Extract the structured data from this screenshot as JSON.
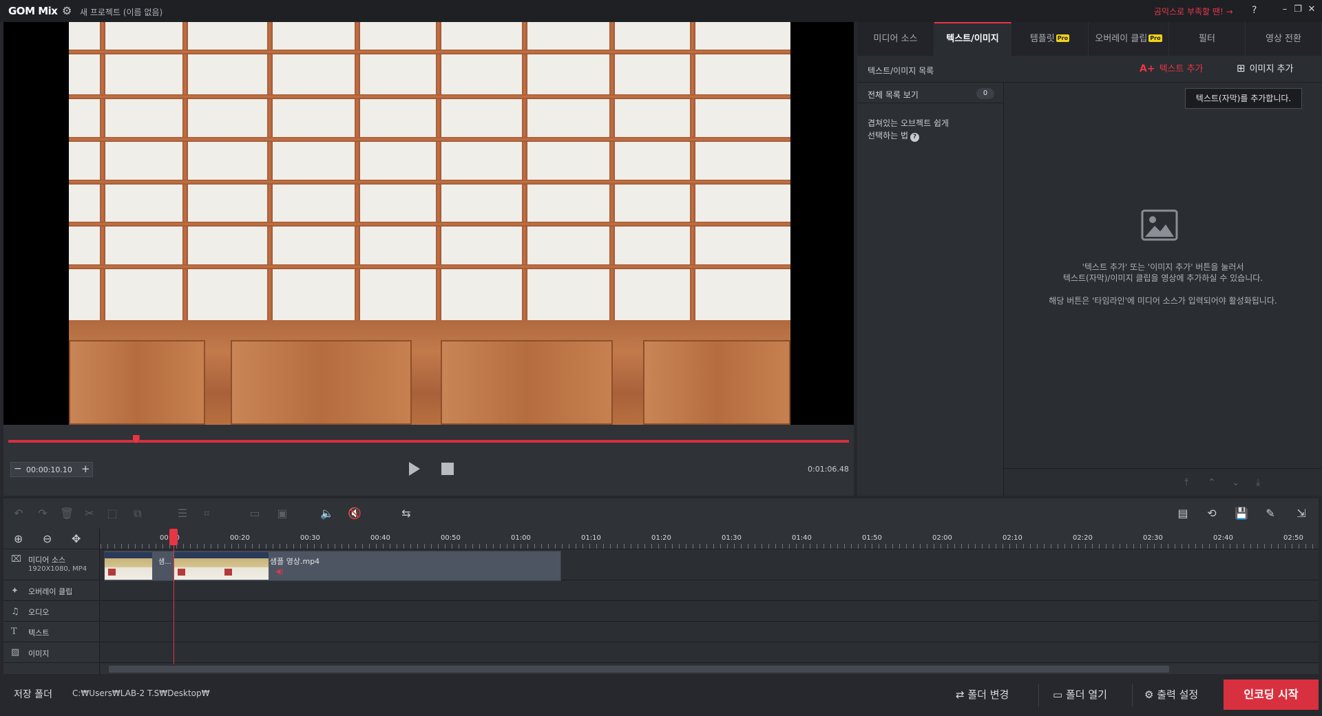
{
  "app": {
    "logo": "GOM Mix",
    "project_title": "새 프로젝트 (이름 없음)",
    "shortage_link": "곰믹스로 부족할 땐! →",
    "help": "?"
  },
  "preview": {
    "timecode": "00:00:10.10",
    "duration": "0:01:06.48",
    "progress_fraction": 0.152
  },
  "right_panel": {
    "tabs": [
      {
        "label": "미디어 소스",
        "pro": false
      },
      {
        "label": "텍스트/이미지",
        "pro": false
      },
      {
        "label": "템플릿",
        "pro": true
      },
      {
        "label": "오버레이 클립",
        "pro": true
      },
      {
        "label": "필터",
        "pro": false
      },
      {
        "label": "영상 전환",
        "pro": false
      }
    ],
    "pro_badge": "Pro",
    "active_tab": "텍스트/이미지",
    "list_title": "텍스트/이미지 목록",
    "add_text": "텍스트 추가",
    "add_image": "이미지 추가",
    "all_list": "전체 목록 보기",
    "all_count": "0",
    "tip_line1": "겹쳐있는 오브젝트 쉽게",
    "tip_line2": "선택하는 법",
    "tooltip": "텍스트(자막)를 추가합니다.",
    "empty_msg1": "'텍스트 추가' 또는 '이미지 추가' 버튼을 눌러서",
    "empty_msg2": "텍스트(자막)/이미지 클립을 영상에 추가하실 수 있습니다.",
    "empty_msg3": "해당 버튼은 '타임라인'에 미디어 소스가 입력되어야 활성화됩니다."
  },
  "timeline": {
    "ticks": [
      "00:10",
      "00:20",
      "00:30",
      "00:40",
      "00:50",
      "01:00",
      "01:10",
      "01:20",
      "01:30",
      "01:40",
      "01:50",
      "02:00",
      "02:10",
      "02:20",
      "02:30",
      "02:40",
      "02:50"
    ],
    "tracks": {
      "media": "미디어 소스",
      "media_info": "1920X1080, MP4",
      "overlay": "오버레이 클립",
      "audio": "오디오",
      "text": "텍스트",
      "image": "이미지"
    },
    "clip_name": "샘플 영상.mp4",
    "clip_short": "샘..."
  },
  "bottom": {
    "save_folder": "저장 폴더",
    "save_path": "C:₩Users₩LAB-2 T.S₩Desktop₩",
    "change_folder": "폴더 변경",
    "open_folder": "폴더 열기",
    "output_settings": "출력 설정",
    "encode": "인코딩 시작"
  },
  "colors": {
    "accent": "#e83545",
    "pro_badge": "#f1d21b"
  }
}
